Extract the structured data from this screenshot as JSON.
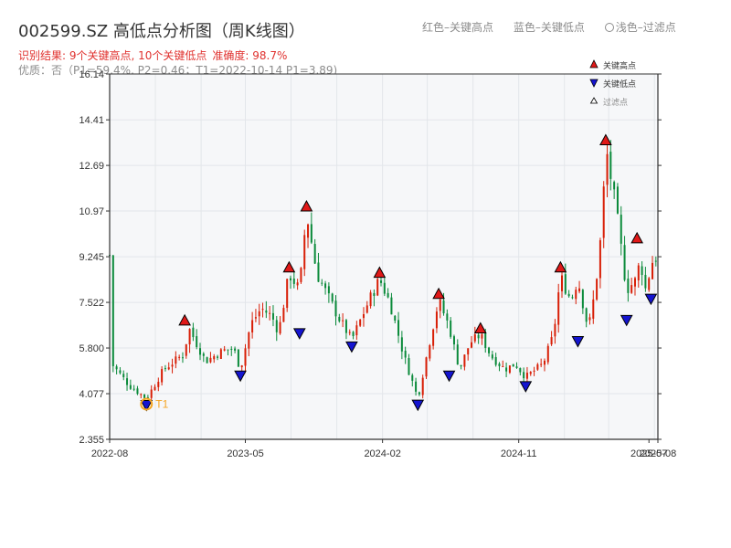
{
  "header": {
    "title": "002599.SZ 高低点分析图（周K线图）",
    "result": "识别结果: 9个关键高点, 10个关键低点",
    "accuracy": "准确度: 98.7%",
    "quality": "优质：否（P1=59.4%, P2=0.46；T1=2022-10-14 P1=3.89)"
  },
  "top_legend": {
    "red": "红色–关键高点",
    "blue": "蓝色–关键低点",
    "light": "浅色–过滤点"
  },
  "colors": {
    "up": "#d81e06",
    "down": "#0a8a3a",
    "high": "#e01818",
    "low": "#1414d0",
    "t1": "#f5a623",
    "grid": "#e3e6ea",
    "plot_bg": "#f6f7f9"
  },
  "chart_data": {
    "type": "candlestick",
    "title": "002599.SZ 高低点分析图（周K线图）",
    "x_ticks": [
      "2022-08",
      "2023-05",
      "2024-02",
      "2024-11",
      "2025-07",
      "2025-08"
    ],
    "y_ticks": [
      "2.355",
      "4.077",
      "5.800",
      "7.522",
      "9.245",
      "10.97",
      "12.69",
      "14.41",
      "16.14"
    ],
    "ylim": [
      2.355,
      16.14
    ],
    "x_range": [
      "2022-08-01",
      "2025-08-08"
    ],
    "grid": true,
    "legend": {
      "high": "关键高点",
      "low": "关键低点",
      "filtered": "过滤点",
      "placement": "top-right"
    },
    "t1_label": "T1",
    "t1": {
      "date": "2022-10-14",
      "price": 3.89
    },
    "anchors": [
      [
        "2022-08-05",
        5.2
      ],
      [
        "2022-09-09",
        4.4
      ],
      [
        "2022-10-14",
        3.89
      ],
      [
        "2022-11-18",
        5.0
      ],
      [
        "2022-12-30",
        5.6
      ],
      [
        "2023-01-06",
        6.6
      ],
      [
        "2023-02-10",
        5.3
      ],
      [
        "2023-03-17",
        5.7
      ],
      [
        "2023-04-07",
        5.8
      ],
      [
        "2023-04-21",
        5.0
      ],
      [
        "2023-05-12",
        6.7
      ],
      [
        "2023-06-02",
        7.3
      ],
      [
        "2023-06-23",
        7.0
      ],
      [
        "2023-07-07",
        6.4
      ],
      [
        "2023-07-28",
        8.6
      ],
      [
        "2023-08-18",
        8.0
      ],
      [
        "2023-09-01",
        10.9
      ],
      [
        "2023-09-22",
        8.6
      ],
      [
        "2023-10-13",
        7.8
      ],
      [
        "2023-11-03",
        7.0
      ],
      [
        "2023-12-01",
        6.1
      ],
      [
        "2024-01-05",
        7.6
      ],
      [
        "2024-01-26",
        8.4
      ],
      [
        "2024-02-16",
        7.5
      ],
      [
        "2024-03-15",
        5.5
      ],
      [
        "2024-04-12",
        3.9
      ],
      [
        "2024-05-03",
        5.8
      ],
      [
        "2024-05-24",
        7.6
      ],
      [
        "2024-06-14",
        6.6
      ],
      [
        "2024-07-05",
        5.0
      ],
      [
        "2024-07-26",
        6.0
      ],
      [
        "2024-08-16",
        6.3
      ],
      [
        "2024-09-06",
        5.5
      ],
      [
        "2024-10-04",
        5.0
      ],
      [
        "2024-10-25",
        5.2
      ],
      [
        "2024-11-15",
        4.7
      ],
      [
        "2024-12-06",
        5.0
      ],
      [
        "2024-12-20",
        5.2
      ],
      [
        "2025-01-10",
        6.3
      ],
      [
        "2025-01-24",
        8.5
      ],
      [
        "2025-02-14",
        7.6
      ],
      [
        "2025-02-28",
        8.4
      ],
      [
        "2025-03-21",
        6.5
      ],
      [
        "2025-04-04",
        8.0
      ],
      [
        "2025-04-18",
        10.5
      ],
      [
        "2025-04-25",
        13.4
      ],
      [
        "2025-05-16",
        11.0
      ],
      [
        "2025-06-06",
        8.0
      ],
      [
        "2025-06-27",
        8.4
      ],
      [
        "2025-07-04",
        9.4
      ],
      [
        "2025-07-11",
        7.9
      ],
      [
        "2025-07-18",
        8.2
      ],
      [
        "2025-07-25",
        9.0
      ],
      [
        "2025-08-08",
        9.3
      ]
    ],
    "key_highs": [
      {
        "date": "2022-12-30",
        "price": 6.6
      },
      {
        "date": "2023-07-28",
        "price": 8.6
      },
      {
        "date": "2023-09-01",
        "price": 10.9
      },
      {
        "date": "2024-01-26",
        "price": 8.4
      },
      {
        "date": "2024-05-24",
        "price": 7.6
      },
      {
        "date": "2024-08-16",
        "price": 6.3
      },
      {
        "date": "2025-01-24",
        "price": 8.6
      },
      {
        "date": "2025-04-25",
        "price": 13.4
      },
      {
        "date": "2025-06-27",
        "price": 9.7
      }
    ],
    "key_lows": [
      {
        "date": "2022-10-14",
        "price": 3.89
      },
      {
        "date": "2023-04-21",
        "price": 5.0
      },
      {
        "date": "2023-08-18",
        "price": 6.6
      },
      {
        "date": "2023-12-01",
        "price": 6.1
      },
      {
        "date": "2024-04-12",
        "price": 3.9
      },
      {
        "date": "2024-06-14",
        "price": 5.0
      },
      {
        "date": "2024-11-15",
        "price": 4.6
      },
      {
        "date": "2025-02-28",
        "price": 6.3
      },
      {
        "date": "2025-06-06",
        "price": 7.1
      },
      {
        "date": "2025-07-25",
        "price": 7.9
      }
    ]
  }
}
